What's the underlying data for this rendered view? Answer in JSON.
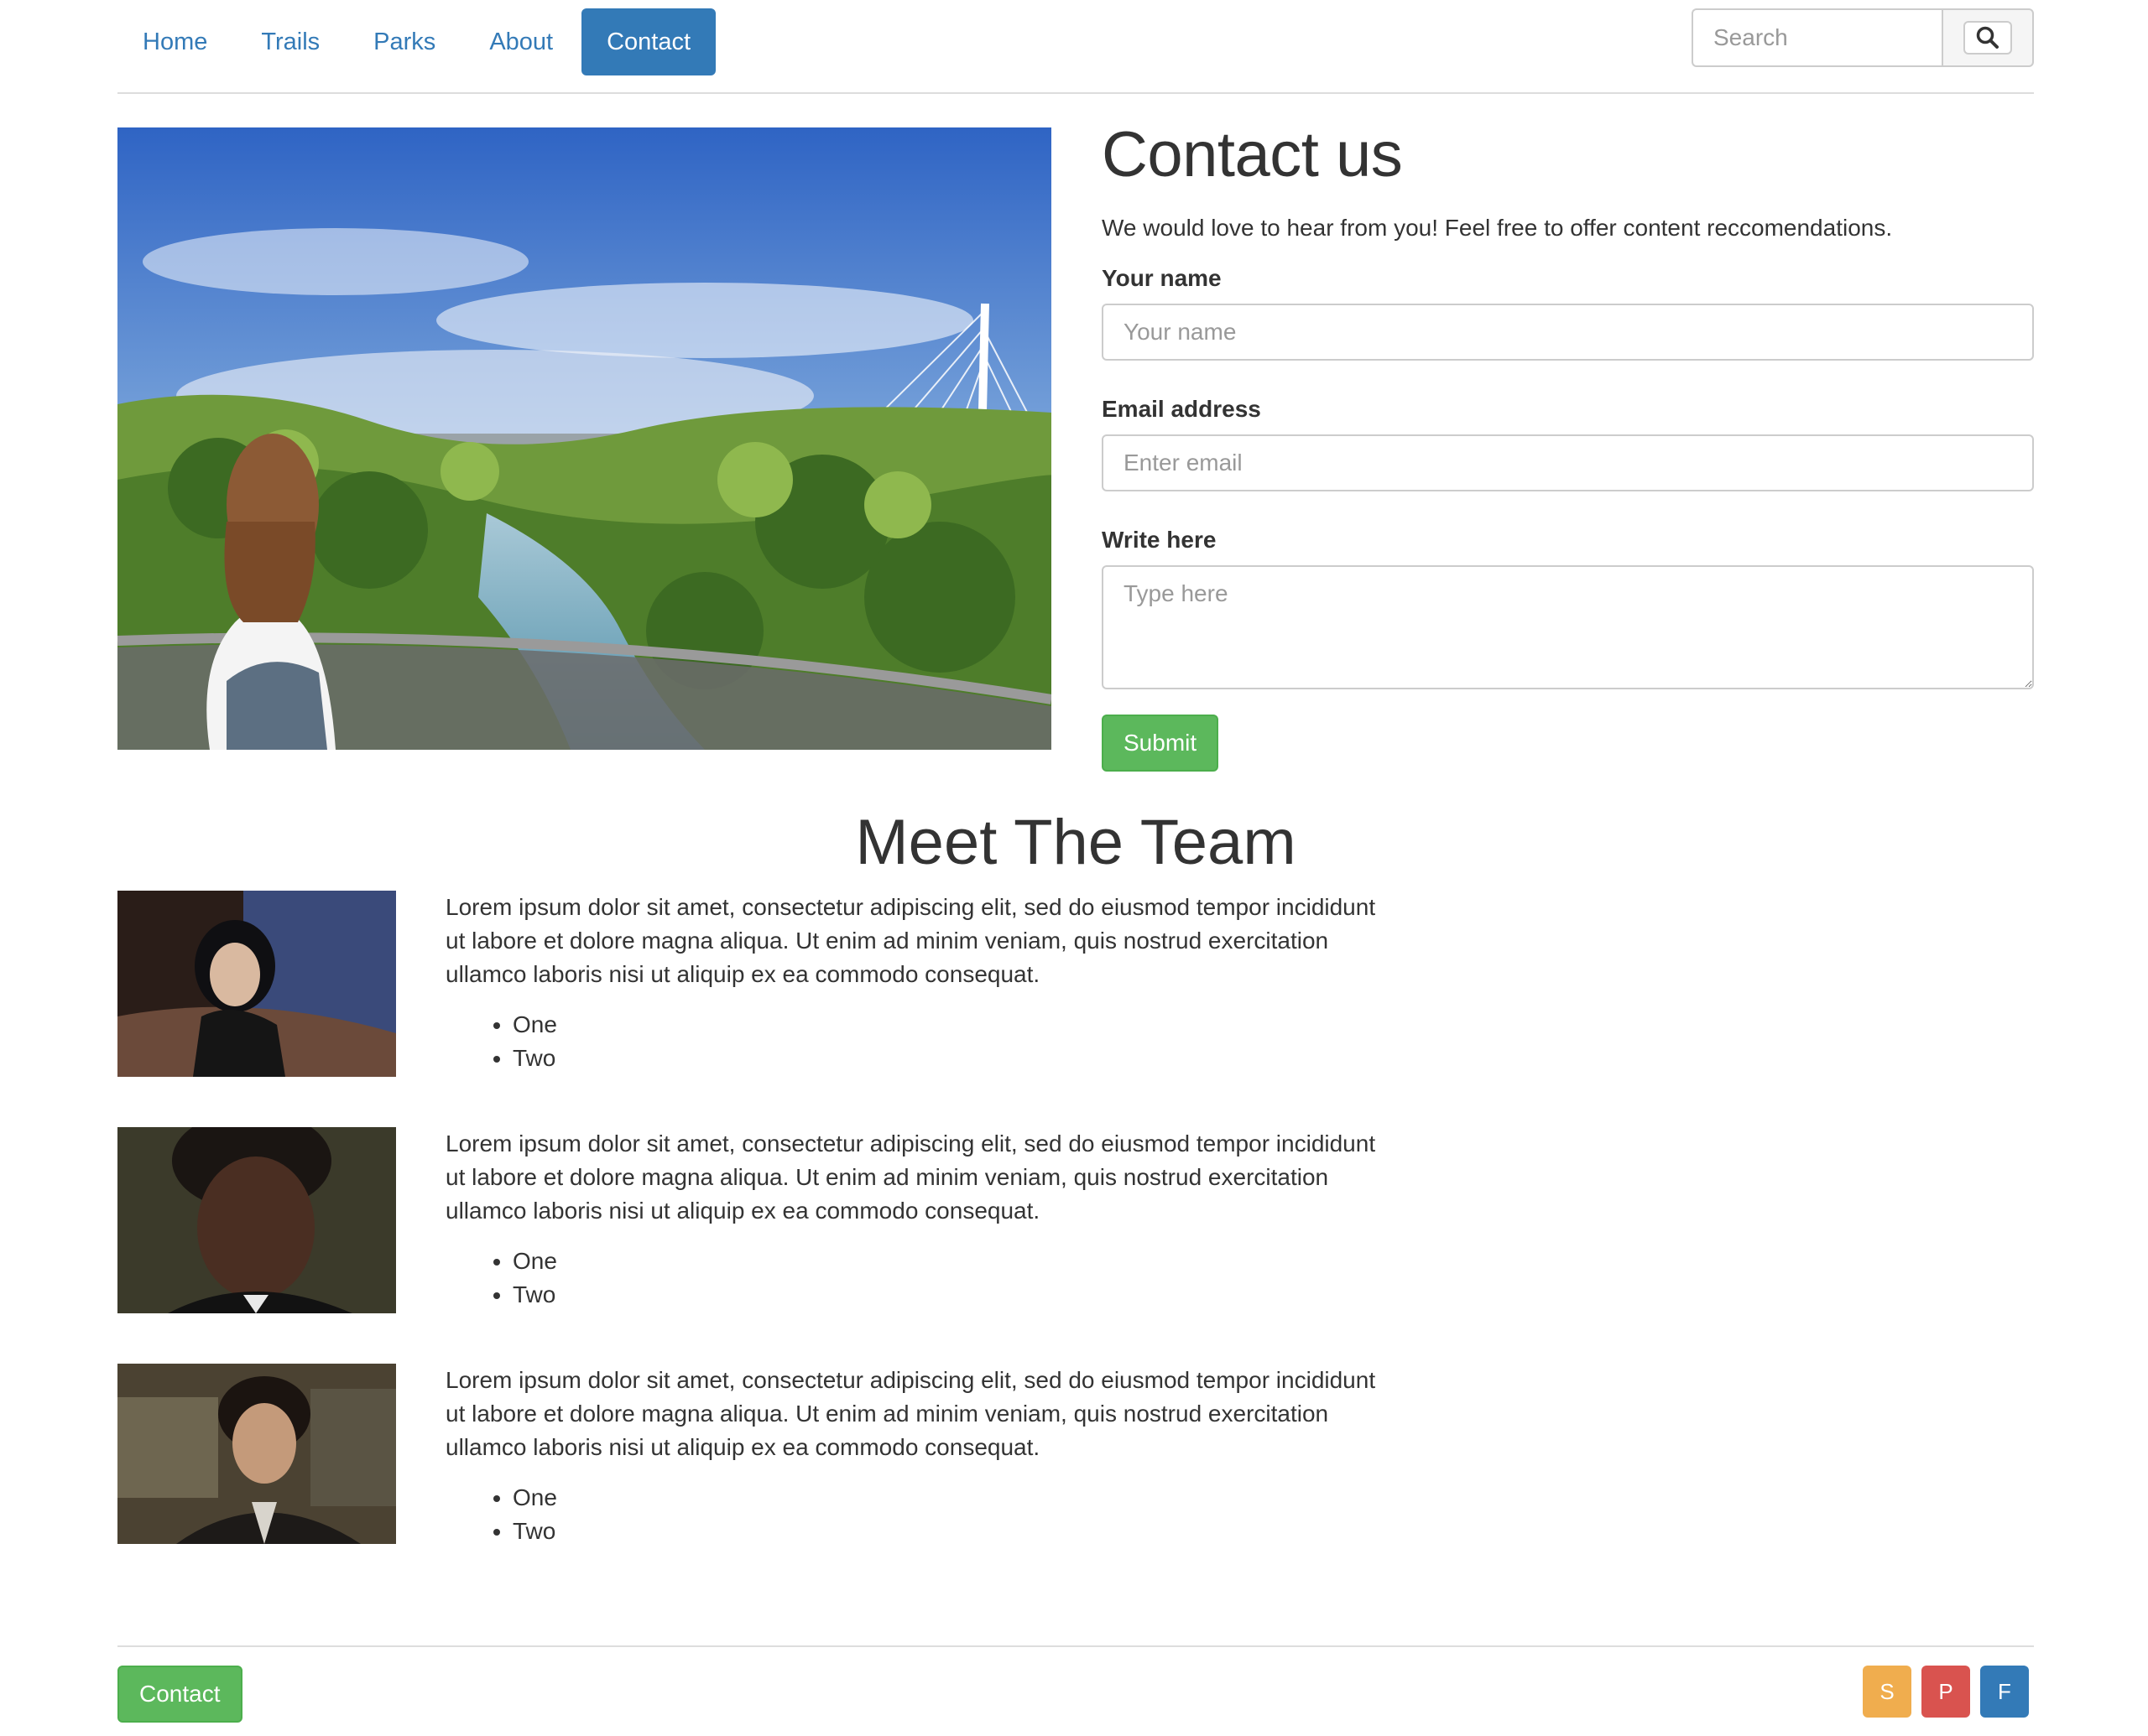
{
  "nav": {
    "items": [
      {
        "label": "Home"
      },
      {
        "label": "Trails"
      },
      {
        "label": "Parks"
      },
      {
        "label": "About"
      },
      {
        "label": "Contact",
        "active": true
      }
    ]
  },
  "search": {
    "placeholder": "Search",
    "icon": "search-icon"
  },
  "hero": {
    "alt": "Park view with river, trees and a white cable-stayed bridge"
  },
  "contact": {
    "title": "Contact us",
    "lead": "We would love to hear from you! Feel free to offer content reccomendations.",
    "name_label": "Your name",
    "name_placeholder": "Your name",
    "email_label": "Email address",
    "email_placeholder": "Enter email",
    "message_label": "Write here",
    "message_placeholder": "Type here",
    "submit_label": "Submit"
  },
  "team": {
    "title": "Meet The Team",
    "members": [
      {
        "bio": "Lorem ipsum dolor sit amet, consectetur adipiscing elit, sed do eiusmod tempor incididunt ut labore et dolore magna aliqua. Ut enim ad minim veniam, quis nostrud exercitation ullamco laboris nisi ut aliquip ex ea commodo consequat.",
        "items": [
          "One",
          "Two"
        ]
      },
      {
        "bio": "Lorem ipsum dolor sit amet, consectetur adipiscing elit, sed do eiusmod tempor incididunt ut labore et dolore magna aliqua. Ut enim ad minim veniam, quis nostrud exercitation ullamco laboris nisi ut aliquip ex ea commodo consequat.",
        "items": [
          "One",
          "Two"
        ]
      },
      {
        "bio": "Lorem ipsum dolor sit amet, consectetur adipiscing elit, sed do eiusmod tempor incididunt ut labore et dolore magna aliqua. Ut enim ad minim veniam, quis nostrud exercitation ullamco laboris nisi ut aliquip ex ea commodo consequat.",
        "items": [
          "One",
          "Two"
        ]
      }
    ]
  },
  "footer": {
    "contact_label": "Contact",
    "social": [
      {
        "label": "S",
        "color": "#f0ad4e"
      },
      {
        "label": "P",
        "color": "#d9534f"
      },
      {
        "label": "F",
        "color": "#337ab7"
      }
    ]
  },
  "colors": {
    "primary": "#337ab7",
    "success": "#5cb85c",
    "border": "#cccccc"
  }
}
